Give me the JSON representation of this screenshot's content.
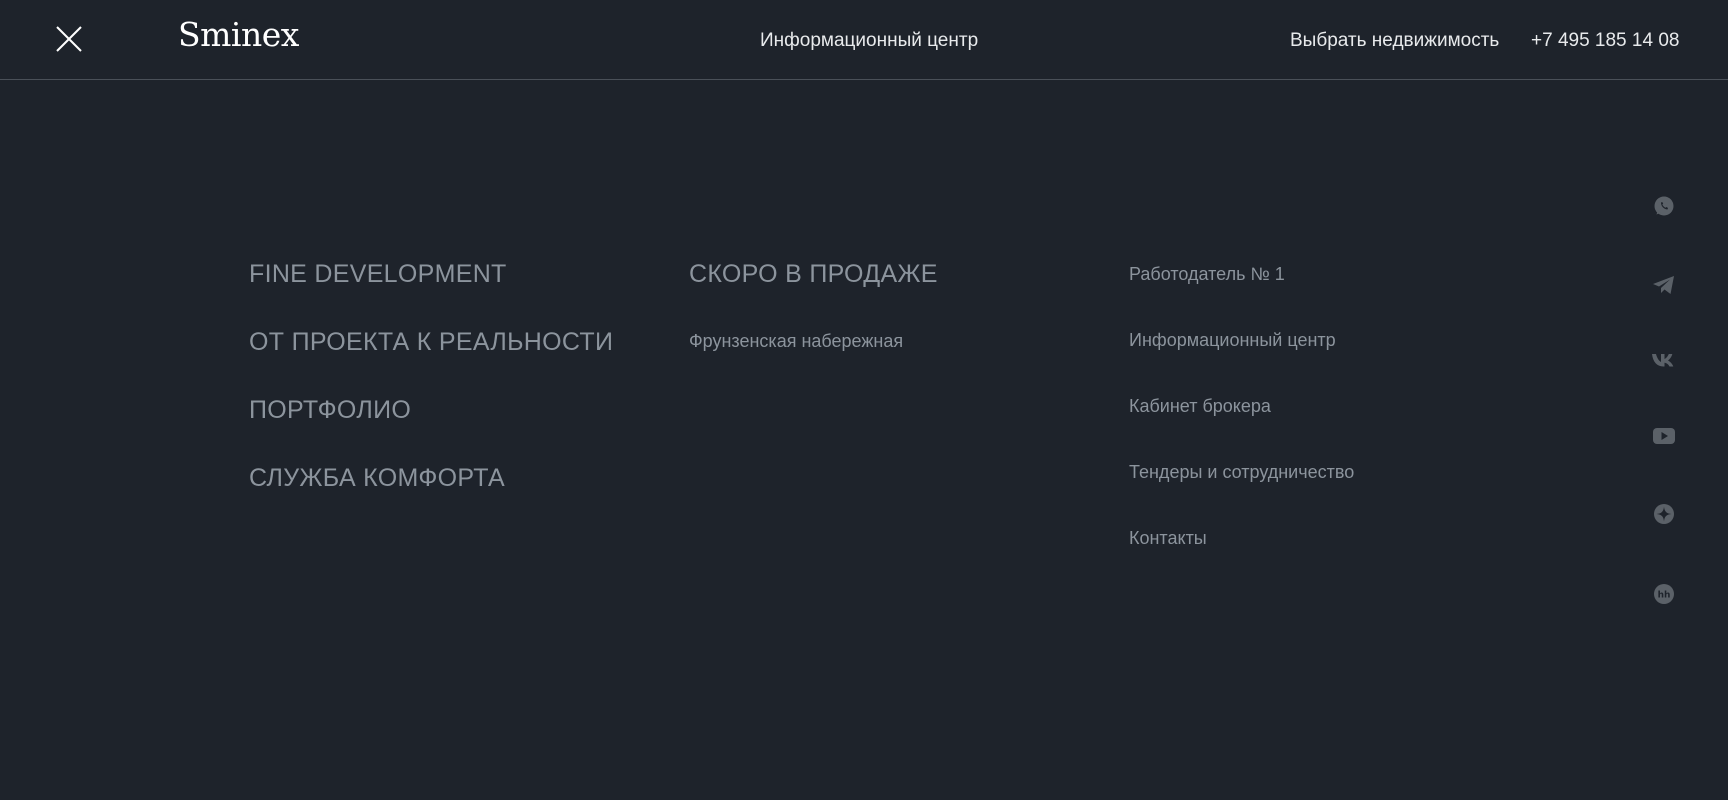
{
  "header": {
    "logo": "Sminex",
    "center_link": "Информационный центр",
    "choose_property": "Выбрать недвижимость",
    "phone": "+7 495 185 14 08"
  },
  "menu": {
    "primary": [
      {
        "label": "FINE DEVELOPMENT"
      },
      {
        "label": "ОТ ПРОЕКТА К РЕАЛЬНОСТИ"
      },
      {
        "label": "ПОРТФОЛИО"
      },
      {
        "label": "СЛУЖБА КОМФОРТА"
      }
    ],
    "soon": {
      "title": "СКОРО В ПРОДАЖЕ",
      "items": [
        {
          "label": "Фрунзенская набережная"
        }
      ]
    },
    "secondary": [
      {
        "label": "Работодатель № 1"
      },
      {
        "label": "Информационный центр"
      },
      {
        "label": "Кабинет брокера"
      },
      {
        "label": "Тендеры и сотрудничество"
      },
      {
        "label": "Контакты"
      }
    ]
  },
  "social": [
    {
      "icon": "whatsapp-icon"
    },
    {
      "icon": "telegram-icon"
    },
    {
      "icon": "vk-icon"
    },
    {
      "icon": "youtube-icon"
    },
    {
      "icon": "dzen-icon"
    },
    {
      "icon": "hh-icon"
    }
  ],
  "colors": {
    "background": "#1e232b",
    "muted_text": "#8c949d",
    "header_text": "#e8eaec",
    "icon": "#5b6168"
  }
}
